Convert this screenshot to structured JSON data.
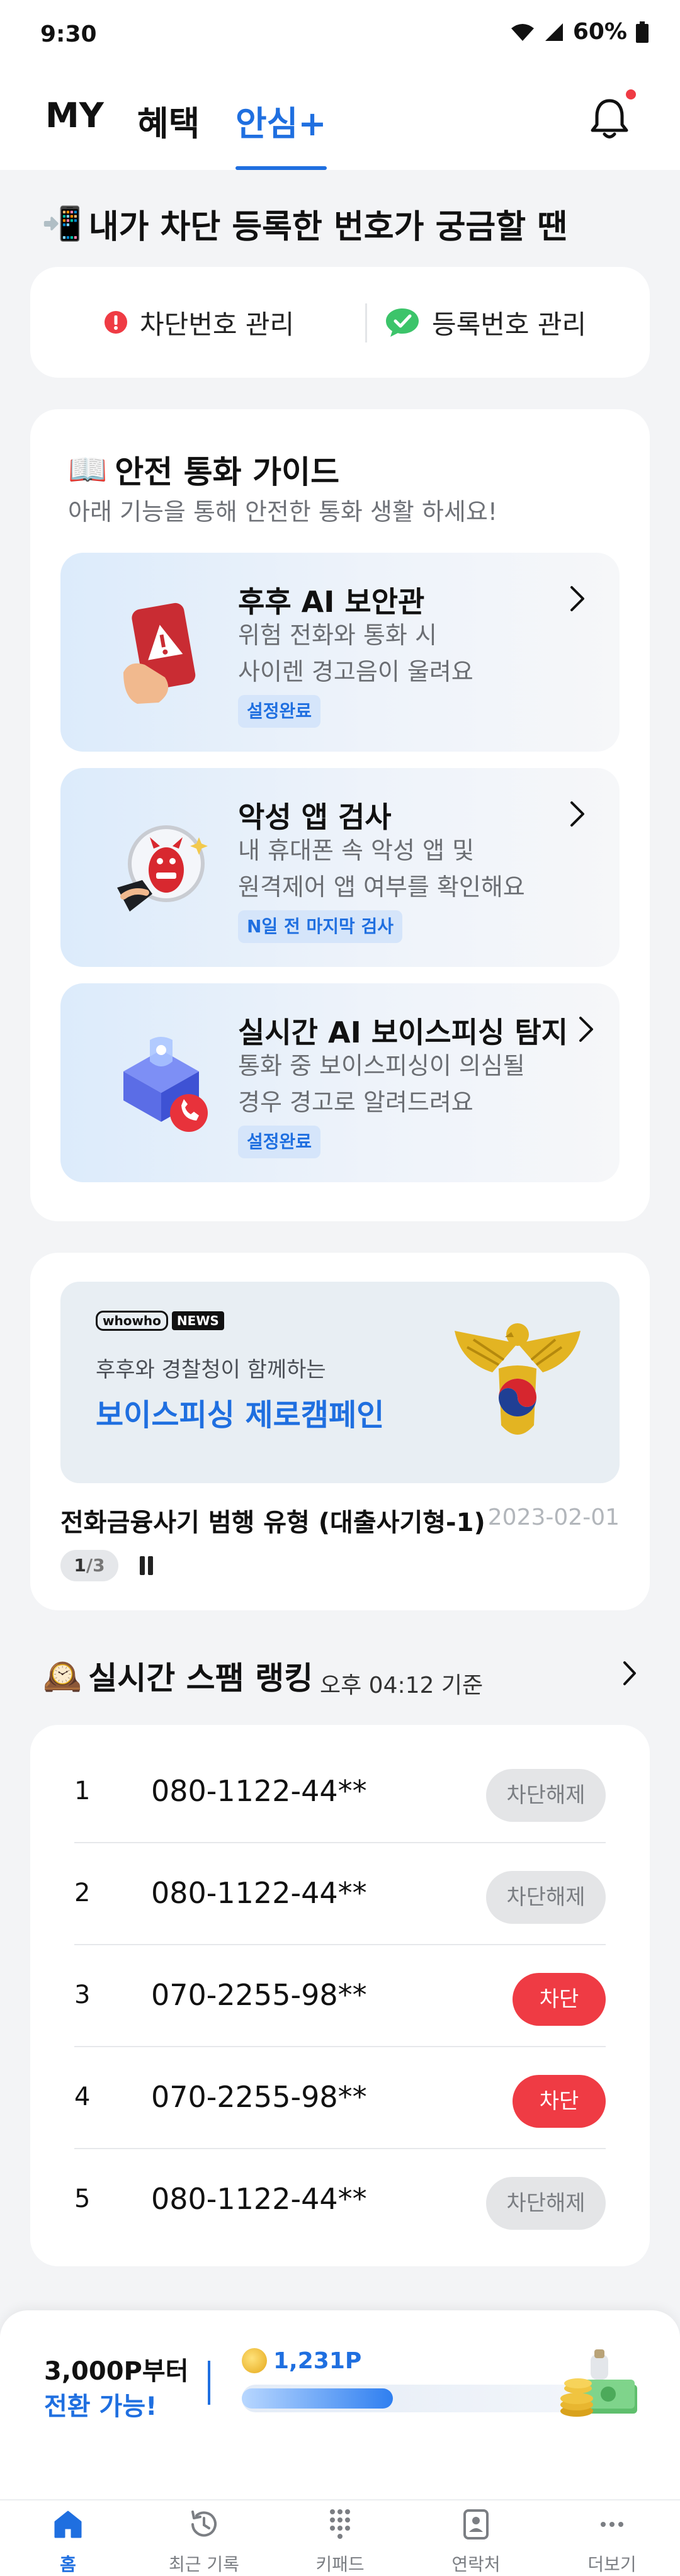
{
  "status_bar": {
    "time": "9:30",
    "battery": "60%"
  },
  "top_tabs": [
    {
      "label": "MY",
      "active": false
    },
    {
      "label": "혜택",
      "active": false
    },
    {
      "label": "안심+",
      "active": true
    }
  ],
  "blocked_section": {
    "emoji": "📲",
    "title": "내가 차단 등록한 번호가 궁금할 땐",
    "blocked_manage": "차단번호 관리",
    "registered_manage": "등록번호 관리"
  },
  "guide": {
    "emoji": "📖",
    "title": "안전 통화 가이드",
    "subtitle": "아래 기능을 통해 안전한 통화 생활 하세요!",
    "items": [
      {
        "title": "후후 AI 보안관",
        "desc1": "위험 전화와 통화 시",
        "desc2": "사이렌 경고음이 울려요",
        "badge": "설정완료"
      },
      {
        "title": "악성 앱 검사",
        "desc1": "내 휴대폰 속 악성 앱 및",
        "desc2": "원격제어 앱 여부를 확인해요",
        "badge": "N일 전 마지막 검사"
      },
      {
        "title": "실시간 AI 보이스피싱 탐지",
        "desc1": "통화 중 보이스피싱이 의심될",
        "desc2": "경우 경고로 알려드려요",
        "badge": "설정완료"
      }
    ]
  },
  "news": {
    "logo_whowho": "whowho",
    "logo_news": "NEWS",
    "banner_small": "후후와 경찰청이 함께하는",
    "banner_big": "보이스피싱 제로캠페인",
    "caption": "전화금융사기 범행 유형 (대출사기형-1)",
    "date": "2023-02-01",
    "page_current": "1",
    "page_total": "/3"
  },
  "spam_ranking": {
    "emoji": "🕰️",
    "title": "실시간 스팸 랭킹",
    "time": "오후 04:12 기준",
    "rows": [
      {
        "rank": "1",
        "phone": "080-1122-44**",
        "button": "차단해제",
        "status": "unblock"
      },
      {
        "rank": "2",
        "phone": "080-1122-44**",
        "button": "차단해제",
        "status": "unblock"
      },
      {
        "rank": "3",
        "phone": "070-2255-98**",
        "button": "차단",
        "status": "block"
      },
      {
        "rank": "4",
        "phone": "070-2255-98**",
        "button": "차단",
        "status": "block"
      },
      {
        "rank": "5",
        "phone": "080-1122-44**",
        "button": "차단해제",
        "status": "unblock"
      }
    ]
  },
  "points": {
    "line1": "3,000P부터",
    "line2": "전환 가능!",
    "value": "1,231P",
    "progress": 0.41
  },
  "bottom_nav": [
    {
      "label": "홈",
      "icon": "home-icon",
      "active": true
    },
    {
      "label": "최근 기록",
      "icon": "history-icon",
      "active": false
    },
    {
      "label": "키패드",
      "icon": "keypad-icon",
      "active": false
    },
    {
      "label": "연락처",
      "icon": "contacts-icon",
      "active": false
    },
    {
      "label": "더보기",
      "icon": "more-icon",
      "active": false
    }
  ],
  "colors": {
    "accent": "#1f6fe0",
    "danger": "#ef3b44",
    "background": "#f3f4f6"
  }
}
